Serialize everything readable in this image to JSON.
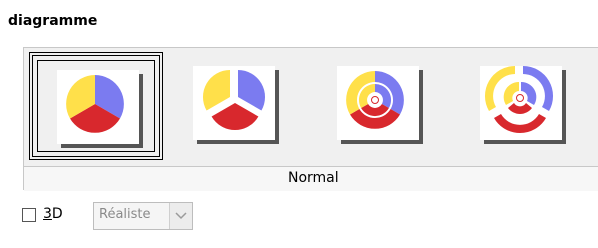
{
  "section": {
    "title": "diagramme"
  },
  "variants": {
    "items": [
      {
        "name": "normal",
        "selected": true
      },
      {
        "name": "exploded",
        "selected": false
      },
      {
        "name": "donut",
        "selected": false
      },
      {
        "name": "exploded-donut",
        "selected": false
      }
    ],
    "caption": "Normal"
  },
  "options": {
    "three_d_label_prefix": "",
    "three_d_mnemonic": "3",
    "three_d_label_rest": "D",
    "three_d_checked": false,
    "style_combo": {
      "value": "Réaliste",
      "enabled": false
    }
  },
  "colors": {
    "blue": "#7b7bf0",
    "yellow": "#ffe04a",
    "red": "#d8282d",
    "selection": "#000000"
  }
}
